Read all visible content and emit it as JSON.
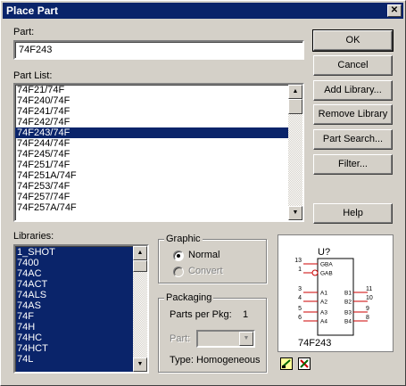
{
  "title": "Place Part",
  "close_glyph": "✕",
  "part": {
    "label": "Part:",
    "value": "74F243"
  },
  "part_list": {
    "label": "Part List:",
    "items": [
      "74F21/74F",
      "74F240/74F",
      "74F241/74F",
      "74F242/74F",
      "74F243/74F",
      "74F244/74F",
      "74F245/74F",
      "74F251/74F",
      "74F251A/74F",
      "74F253/74F",
      "74F257/74F",
      "74F257A/74F"
    ]
  },
  "libraries": {
    "label": "Libraries:",
    "items": [
      "1_SHOT",
      "7400",
      "74AC",
      "74ACT",
      "74ALS",
      "74AS",
      "74F",
      "74H",
      "74HC",
      "74HCT",
      "74L"
    ]
  },
  "buttons": {
    "ok": "OK",
    "cancel": "Cancel",
    "add_library": "Add Library...",
    "remove_library": "Remove Library",
    "part_search": "Part Search...",
    "filter": "Filter...",
    "help": "Help"
  },
  "graphic": {
    "title": "Graphic",
    "normal": "Normal",
    "convert": "Convert"
  },
  "packaging": {
    "title": "Packaging",
    "parts_per_pkg_label": "Parts per Pkg:",
    "parts_per_pkg_value": "1",
    "part_label": "Part:",
    "type_label": "Type:",
    "type_value": "Homogeneous"
  },
  "preview": {
    "refdes": "U?",
    "part_name": "74F243",
    "pins_left_nums": [
      "13",
      "1",
      "3",
      "4",
      "5",
      "6"
    ],
    "pins_left_names": [
      "GBA",
      "GAB",
      "A1",
      "A2",
      "A3",
      "A4"
    ],
    "pins_right_names": [
      "B1",
      "B2",
      "B3",
      "B4"
    ],
    "pins_right_nums": [
      "11",
      "10",
      "9",
      "8"
    ]
  },
  "colors": {
    "title_bar": "#0a246a",
    "selection": "#0a246a",
    "pin": "#cc0000"
  },
  "icons": [
    "scroll-up-icon",
    "scroll-down-icon",
    "combo-arrow-icon",
    "preview-zoom-icon",
    "preview-pins-icon"
  ]
}
